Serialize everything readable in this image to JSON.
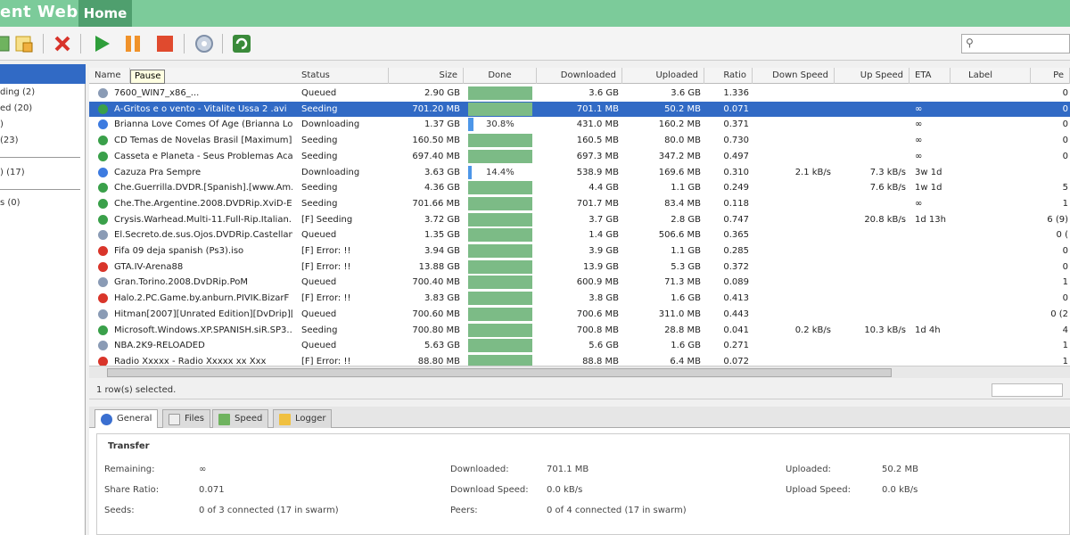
{
  "app": {
    "title": "ent Web",
    "home_tab": "Home"
  },
  "toolbar": {
    "pause_tooltip": "Pause"
  },
  "sidebar": {
    "items": [
      "ding (2)",
      "ed (20)",
      ")",
      "(23)",
      ") (17)",
      "s (0)"
    ]
  },
  "columns": [
    "Name",
    "Status",
    "Size",
    "Done",
    "Downloaded",
    "Uploaded",
    "Ratio",
    "Down Speed",
    "Up Speed",
    "ETA",
    "Label",
    "Pe"
  ],
  "rows": [
    {
      "icon": "queued",
      "name": "7600_WIN7_x86_...",
      "status": "Queued",
      "size": "2.90 GB",
      "done_pct": 100,
      "done_label": "",
      "downloaded": "3.6 GB",
      "uploaded": "3.6 GB",
      "ratio": "1.336",
      "down": "",
      "up": "",
      "eta": "",
      "peers": "0",
      "selected": false
    },
    {
      "icon": "seed",
      "name": "A-Gritos e o vento - Vitalite Ussa 2 .avi",
      "status": "Seeding",
      "size": "701.20 MB",
      "done_pct": 100,
      "done_label": "",
      "downloaded": "701.1 MB",
      "uploaded": "50.2 MB",
      "ratio": "0.071",
      "down": "",
      "up": "",
      "eta": "∞",
      "peers": "0",
      "selected": true
    },
    {
      "icon": "down",
      "name": "Brianna Love Comes Of Age (Brianna Lo...",
      "status": "Downloading",
      "size": "1.37 GB",
      "done_pct": 8,
      "done_label": "30.8%",
      "downloaded": "431.0 MB",
      "uploaded": "160.2 MB",
      "ratio": "0.371",
      "down": "",
      "up": "",
      "eta": "∞",
      "peers": "0",
      "selected": false
    },
    {
      "icon": "seed",
      "name": "CD Temas de Novelas Brasil [Maximum]",
      "status": "Seeding",
      "size": "160.50 MB",
      "done_pct": 100,
      "done_label": "",
      "downloaded": "160.5 MB",
      "uploaded": "80.0 MB",
      "ratio": "0.730",
      "down": "",
      "up": "",
      "eta": "∞",
      "peers": "0",
      "selected": false
    },
    {
      "icon": "seed",
      "name": "Casseta e Planeta - Seus Problemas Aca...",
      "status": "Seeding",
      "size": "697.40 MB",
      "done_pct": 100,
      "done_label": "",
      "downloaded": "697.3 MB",
      "uploaded": "347.2 MB",
      "ratio": "0.497",
      "down": "",
      "up": "",
      "eta": "∞",
      "peers": "0",
      "selected": false
    },
    {
      "icon": "down",
      "name": "Cazuza Pra Sempre",
      "status": "Downloading",
      "size": "3.63 GB",
      "done_pct": 5,
      "done_label": "14.4%",
      "downloaded": "538.9 MB",
      "uploaded": "169.6 MB",
      "ratio": "0.310",
      "down": "2.1 kB/s",
      "up": "7.3 kB/s",
      "eta": "3w 1d",
      "peers": "",
      "selected": false
    },
    {
      "icon": "seed",
      "name": "Che.Guerrilla.DVDR.[Spanish].[www.Am...",
      "status": "Seeding",
      "size": "4.36 GB",
      "done_pct": 100,
      "done_label": "",
      "downloaded": "4.4 GB",
      "uploaded": "1.1 GB",
      "ratio": "0.249",
      "down": "",
      "up": "7.6 kB/s",
      "eta": "1w 1d",
      "peers": "5",
      "selected": false
    },
    {
      "icon": "seed",
      "name": "Che.The.Argentine.2008.DVDRip.XviD-E...",
      "status": "Seeding",
      "size": "701.66 MB",
      "done_pct": 100,
      "done_label": "",
      "downloaded": "701.7 MB",
      "uploaded": "83.4 MB",
      "ratio": "0.118",
      "down": "",
      "up": "",
      "eta": "∞",
      "peers": "1",
      "selected": false
    },
    {
      "icon": "seed",
      "name": "Crysis.Warhead.Multi-11.Full-Rip.Italian...",
      "status": "[F] Seeding",
      "size": "3.72 GB",
      "done_pct": 100,
      "done_label": "",
      "downloaded": "3.7 GB",
      "uploaded": "2.8 GB",
      "ratio": "0.747",
      "down": "",
      "up": "20.8 kB/s",
      "eta": "1d 13h",
      "peers": "6 (9)",
      "selected": false
    },
    {
      "icon": "queued",
      "name": "El.Secreto.de.sus.Ojos.DVDRip.Castellan...",
      "status": "Queued",
      "size": "1.35 GB",
      "done_pct": 100,
      "done_label": "",
      "downloaded": "1.4 GB",
      "uploaded": "506.6 MB",
      "ratio": "0.365",
      "down": "",
      "up": "",
      "eta": "",
      "peers": "0 (",
      "selected": false
    },
    {
      "icon": "error",
      "name": "Fifa 09 deja spanish (Ps3).iso",
      "status": "[F] Error: !!",
      "size": "3.94 GB",
      "done_pct": 100,
      "done_label": "",
      "downloaded": "3.9 GB",
      "uploaded": "1.1 GB",
      "ratio": "0.285",
      "down": "",
      "up": "",
      "eta": "",
      "peers": "0",
      "selected": false
    },
    {
      "icon": "error",
      "name": "GTA.IV-Arena88",
      "status": "[F] Error: !!",
      "size": "13.88 GB",
      "done_pct": 100,
      "done_label": "",
      "downloaded": "13.9 GB",
      "uploaded": "5.3 GB",
      "ratio": "0.372",
      "down": "",
      "up": "",
      "eta": "",
      "peers": "0",
      "selected": false
    },
    {
      "icon": "queued",
      "name": "Gran.Torino.2008.DvDRip.PoM",
      "status": "Queued",
      "size": "700.40 MB",
      "done_pct": 100,
      "done_label": "",
      "downloaded": "600.9 MB",
      "uploaded": "71.3 MB",
      "ratio": "0.089",
      "down": "",
      "up": "",
      "eta": "",
      "peers": "1",
      "selected": false
    },
    {
      "icon": "error",
      "name": "Halo.2.PC.Game.by.anburn.PIVIK.BizarF",
      "status": "[F] Error: !!",
      "size": "3.83 GB",
      "done_pct": 100,
      "done_label": "",
      "downloaded": "3.8 GB",
      "uploaded": "1.6 GB",
      "ratio": "0.413",
      "down": "",
      "up": "",
      "eta": "",
      "peers": "0",
      "selected": false
    },
    {
      "icon": "queued",
      "name": "Hitman[2007][Unrated Edition][DvDrip][In...",
      "status": "Queued",
      "size": "700.60 MB",
      "done_pct": 100,
      "done_label": "",
      "downloaded": "700.6 MB",
      "uploaded": "311.0 MB",
      "ratio": "0.443",
      "down": "",
      "up": "",
      "eta": "",
      "peers": "0 (2",
      "selected": false
    },
    {
      "icon": "seed",
      "name": "Microsoft.Windows.XP.SPANISH.siR.SP3...",
      "status": "Seeding",
      "size": "700.80 MB",
      "done_pct": 100,
      "done_label": "",
      "downloaded": "700.8 MB",
      "uploaded": "28.8 MB",
      "ratio": "0.041",
      "down": "0.2 kB/s",
      "up": "10.3 kB/s",
      "eta": "1d 4h",
      "peers": "4",
      "selected": false
    },
    {
      "icon": "queued",
      "name": "NBA.2K9-RELOADED",
      "status": "Queued",
      "size": "5.63 GB",
      "done_pct": 100,
      "done_label": "",
      "downloaded": "5.6 GB",
      "uploaded": "1.6 GB",
      "ratio": "0.271",
      "down": "",
      "up": "",
      "eta": "",
      "peers": "1",
      "selected": false
    },
    {
      "icon": "error",
      "name": "Radio Xxxxx - Radio Xxxxx xx Xxx",
      "status": "[F] Error: !!",
      "size": "88.80 MB",
      "done_pct": 100,
      "done_label": "",
      "downloaded": "88.8 MB",
      "uploaded": "6.4 MB",
      "ratio": "0.072",
      "down": "",
      "up": "",
      "eta": "",
      "peers": "1",
      "selected": false
    }
  ],
  "status_bar": {
    "selected_text": "1 row(s) selected."
  },
  "tabs": [
    "General",
    "Files",
    "Speed",
    "Logger"
  ],
  "details": {
    "section_title": "Transfer",
    "fields": [
      {
        "label": "Remaining:",
        "value": "∞"
      },
      {
        "label": "Share Ratio:",
        "value": "0.071"
      },
      {
        "label": "Seeds:",
        "value": "0 of 3 connected (17 in swarm)"
      },
      {
        "label": "Downloaded:",
        "value": "701.1 MB"
      },
      {
        "label": "Download Speed:",
        "value": "0.0 kB/s"
      },
      {
        "label": "Peers:",
        "value": "0 of 4 connected (17 in swarm)"
      },
      {
        "label": "Uploaded:",
        "value": "50.2 MB"
      },
      {
        "label": "Upload Speed:",
        "value": "0.0 kB/s"
      }
    ]
  },
  "colors": {
    "titlebar": "#7ccb9a",
    "selection": "#316ac5",
    "done_bar": "#7cbb86",
    "dl_bar": "#4d96e8"
  }
}
